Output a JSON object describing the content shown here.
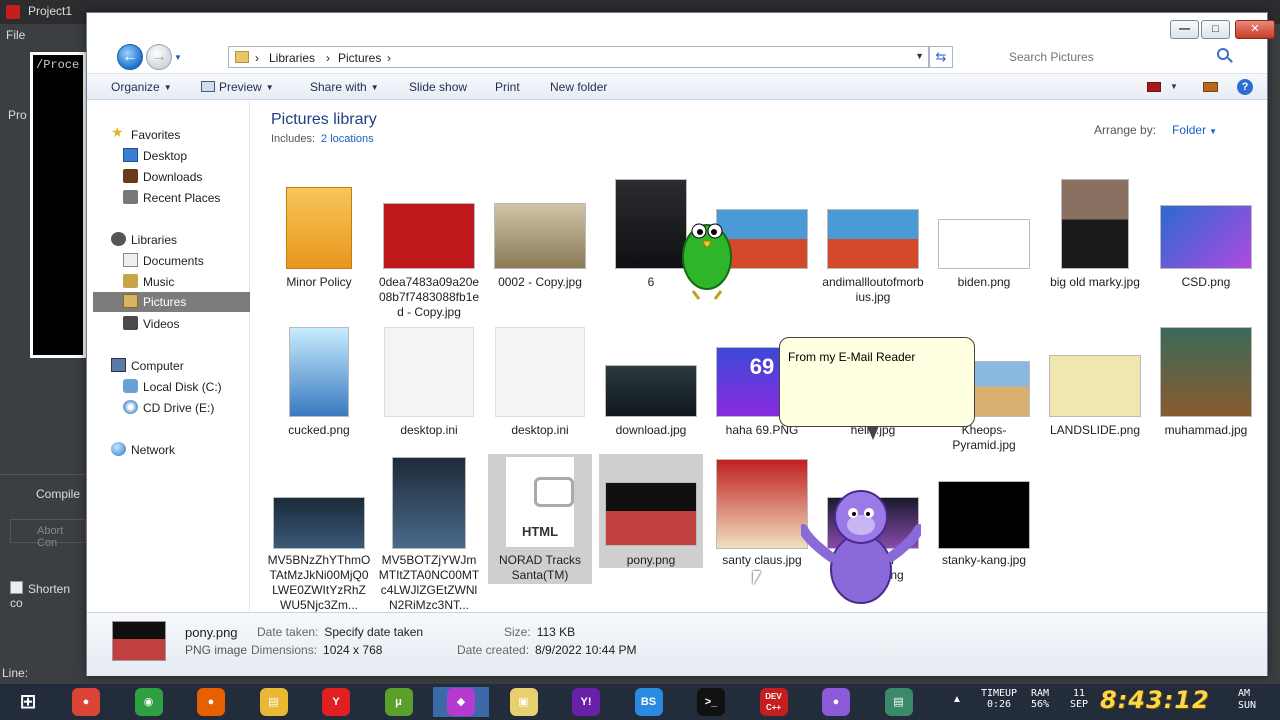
{
  "ide": {
    "title": "Project1",
    "menu_file": "File",
    "console_text": "/Proce",
    "pro_label": "Pro",
    "compile_tab": "Compile",
    "abort_label": "Abort Con",
    "shorten_label": "Shorten co",
    "line_label": "Line:"
  },
  "window": {
    "min": "—",
    "max": "□",
    "close": "✕"
  },
  "nav": {
    "breadcrumb": [
      "Libraries",
      "Pictures"
    ],
    "search_placeholder": "Search Pictures"
  },
  "toolbar": {
    "organize": "Organize",
    "preview": "Preview",
    "share_with": "Share with",
    "slide_show": "Slide show",
    "print": "Print",
    "new_folder": "New folder"
  },
  "navpane": {
    "favorites": "Favorites",
    "desktop": "Desktop",
    "downloads": "Downloads",
    "recent_places": "Recent Places",
    "libraries": "Libraries",
    "documents": "Documents",
    "music": "Music",
    "pictures": "Pictures",
    "videos": "Videos",
    "computer": "Computer",
    "local_disk": "Local Disk (C:)",
    "cd_drive": "CD Drive (E:)",
    "network": "Network"
  },
  "library": {
    "title": "Pictures library",
    "includes_label": "Includes:",
    "includes_link": "2 locations",
    "arrange_label": "Arrange by:",
    "arrange_value": "Folder"
  },
  "files": [
    {
      "name": "Minor Policy"
    },
    {
      "name": "0dea7483a09a20e08b7f7483088fb1ed - Copy.jpg"
    },
    {
      "name": "0002 - Copy.jpg"
    },
    {
      "name": "6"
    },
    {
      "name": ""
    },
    {
      "name": "andimallloutofmorbius.jpg"
    },
    {
      "name": "biden.png"
    },
    {
      "name": "big old marky.jpg"
    },
    {
      "name": "CSD.png"
    },
    {
      "name": "cucked.png"
    },
    {
      "name": "desktop.ini"
    },
    {
      "name": "desktop.ini"
    },
    {
      "name": "download.jpg"
    },
    {
      "name": "haha 69.PNG"
    },
    {
      "name": "hello.jpg"
    },
    {
      "name": "Kheops-Pyramid.jpg"
    },
    {
      "name": "LANDSLIDE.png"
    },
    {
      "name": "muhammad.jpg"
    },
    {
      "name": "MV5BNzZhYThmOTAtMzJkNi00MjQ0LWE0ZWItYzRhZWU5Njc3Zm..."
    },
    {
      "name": "MV5BOTZjYWJmMTItZTA0NC00MTc4LWJlZGEtZWNlN2RiMzc3NT..."
    },
    {
      "name": "NORAD Tracks Santa(TM)",
      "badge": "HTML"
    },
    {
      "name": "pony.png"
    },
    {
      "name": "santy claus.jpg"
    },
    {
      "name": "SHUT IT DOWN.png"
    },
    {
      "name": "stanky-kang.jpg"
    }
  ],
  "thumb_text": {
    "chromium_69": "69"
  },
  "balloon": {
    "text": "From my E-Mail Reader"
  },
  "details": {
    "name": "pony.png",
    "type": "PNG image",
    "date_taken_label": "Date taken:",
    "date_taken_value": "Specify date taken",
    "dimensions_label": "Dimensions:",
    "dimensions_value": "1024 x 768",
    "size_label": "Size:",
    "size_value": "113 KB",
    "date_created_label": "Date created:",
    "date_created_value": "8/9/2022 10:44 PM"
  },
  "taskbar": {
    "apps": [
      {
        "name": "chrome",
        "glyph": "●",
        "color": "#db4437"
      },
      {
        "name": "browser",
        "glyph": "◉",
        "color": "#2ea043"
      },
      {
        "name": "firefox",
        "glyph": "●",
        "color": "#e66000"
      },
      {
        "name": "explorer",
        "glyph": "▤",
        "color": "#e8b935"
      },
      {
        "name": "yandex",
        "glyph": "Y",
        "color": "#e02020"
      },
      {
        "name": "utorrent",
        "glyph": "μ",
        "color": "#5aa02a"
      },
      {
        "name": "gem",
        "glyph": "◆",
        "color": "#b43ad0"
      },
      {
        "name": "folder",
        "glyph": "▣",
        "color": "#e8d070"
      },
      {
        "name": "yahoo",
        "glyph": "Y!",
        "color": "#6a1fa8"
      },
      {
        "name": "bluestacks",
        "glyph": "BS",
        "color": "#2a8ae0"
      },
      {
        "name": "cmd",
        "glyph": ">_",
        "color": "#111111"
      },
      {
        "name": "devcpp",
        "glyph": "DEV C++",
        "color": "#c41e1e"
      },
      {
        "name": "bonzi",
        "glyph": "●",
        "color": "#8a5ad8"
      },
      {
        "name": "notepad",
        "glyph": "▤",
        "color": "#3a8a6a"
      }
    ],
    "timeup_label": "TIMEUP",
    "timeup_value": "0:26",
    "ram_label": "RAM",
    "ram_value": "56%",
    "day": "11",
    "month": "SEP",
    "clock": "8:43:12",
    "ampm": "AM",
    "weekday": "SUN"
  }
}
